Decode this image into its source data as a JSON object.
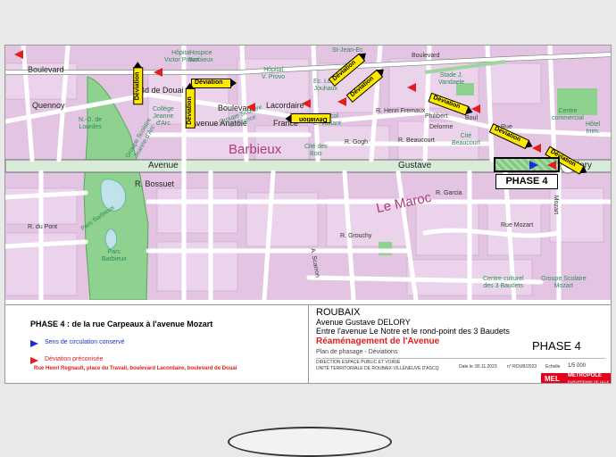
{
  "map": {
    "streets": {
      "boulevard_nw": "Boulevard",
      "bd_de_douai": "Bd de Douai",
      "boulevard_lacordaire_1": "Boulevard",
      "boulevard_lacordaire_2": "Lacordaire",
      "avenue_anatole": "Avenue Anatole",
      "france": "France",
      "quennoy": "Quennoy",
      "avenue_left": "Avenue",
      "gustave": "Gustave",
      "delory": "Delory",
      "r_bossuet": "R. Bossuet",
      "boulevard_ne": "Boulevard",
      "r_henri_fremaux": "R. Henri Fremaux",
      "rue_ne": "Rue",
      "boul_ne": "Boul",
      "philibert": "Philibert",
      "delorme": "Delorme",
      "r_beaucourt": "R. Beaucourt",
      "r_gogh": "R. Gogh",
      "mozart": "Mozart",
      "r_garcia": "R. Garcia",
      "r_grouchy": "R. Grouchy",
      "a_scarron": "A. Scarron",
      "rue_mozart": "Rue Mozart",
      "r_du_pont": "R. du Pont"
    },
    "pois": {
      "hospice_barbieux": "Hospice\nBarbieux",
      "hopital_victor_provo_w": "Hôpital\nVictor Provo",
      "hopital_victor_provo": "Hôpital\nV. Provo",
      "ec_leon_jouhaux": "Ec. Léon\nJouhaux",
      "st_jean_ec": "St-Jean-Ec",
      "stade_vandaele": "Stade J.\nVandaele",
      "college_jeanne_arc": "Collège\nJeanne\nd'Arc",
      "groupe_scolaire_france": "Groupe Scolaire\nA. France",
      "gr_scol_vaillant": "Gr. Scol\nE. Vaillant",
      "nd_de_lourdes": "N.-D. de\nLourdes",
      "groupe_scolaire_jeanne": "Groupe Scolaire\nJeanne d'Arc",
      "cite_bois": "Cité des\nBois",
      "cite_beaucourt": "Cité\nBeaucourt",
      "centre_commercial": "Centre\ncommercial",
      "hotel_imm": "Hôtel\nImm.",
      "parc_barbieux": "Parc Barbieux",
      "parc_barbieux_2": "Parc\nBarbieux",
      "centre_culturel": "Centre culturel\ndes 3 Baudets",
      "groupe_scolaire_mozart": "Groupe Scolaire\nMozart"
    },
    "districts": {
      "barbieux": "Barbieux",
      "le_maroc": "Le Maroc"
    },
    "deviation_label": "Déviation",
    "phase_box": "PHASE 4"
  },
  "legend": {
    "title": "PHASE 4 : de la rue Carpeaux à l'avenue Mozart",
    "blue_label": "Sens de circulation conservé",
    "red_label": "Déviation préconisée",
    "red_detail": "Rue Henri Regnault, place du Travail, boulevard Lacordaire, boulevard de Douai"
  },
  "cartouche": {
    "city": "ROUBAIX",
    "avenue": "Avenue Gustave DELORY",
    "between": "Entre l'avenue Le Notre et le rond-point des 3 Baudets",
    "project": "Réaménagement de l'Avenue",
    "plan": "Plan de phasage - Déviations",
    "phase": "PHASE 4",
    "direction": "DIRECTION ESPACE PUBLIC ET VOIRIE",
    "unite": "UNITÉ TERRITORIALE DE ROUBAIX-VILLENEUVE D'ASCQ",
    "date_label": "Date le :",
    "date": "30.11.2023",
    "ref_label": "n° ROUB/2023",
    "scale_label": "Echelle",
    "scale": "1/5 000",
    "logo_mel": "MEL",
    "logo_metropole": "MÉTROPOLE",
    "logo_sub": "EUROPÉENNE DE LILLE"
  },
  "colors": {
    "map_pink": "#e3c5e3",
    "park_green": "#8fd18f",
    "road": "#ffffff",
    "deviation_yellow": "#ffe800",
    "deviation_red": "#e31d1d",
    "conserved_blue": "#1a2fd6",
    "brand_red": "#e2001a"
  }
}
